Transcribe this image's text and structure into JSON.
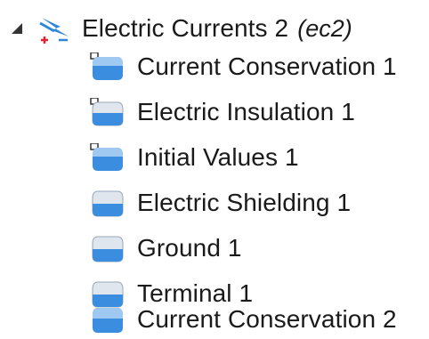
{
  "tree": {
    "root": {
      "label": "Electric Currents 2",
      "tag": "(ec2)",
      "expanded": true,
      "icon": "electric-currents-icon"
    },
    "children": [
      {
        "label": "Current Conservation 1",
        "icon": "default-domain-node-icon"
      },
      {
        "label": "Electric Insulation 1",
        "icon": "default-boundary-node-icon"
      },
      {
        "label": "Initial Values 1",
        "icon": "default-domain-node-icon"
      },
      {
        "label": "Electric Shielding 1",
        "icon": "boundary-node-icon"
      },
      {
        "label": "Ground 1",
        "icon": "boundary-node-icon"
      },
      {
        "label": "Terminal 1",
        "icon": "boundary-node-icon"
      },
      {
        "label": "Current Conservation 2",
        "icon": "domain-node-icon"
      }
    ]
  },
  "colors": {
    "accent": "#2f86d8",
    "icon_fill": "#3b8de0",
    "icon_light": "#dfe6ee",
    "plus": "#e2222e",
    "text": "#1a1a1a"
  }
}
